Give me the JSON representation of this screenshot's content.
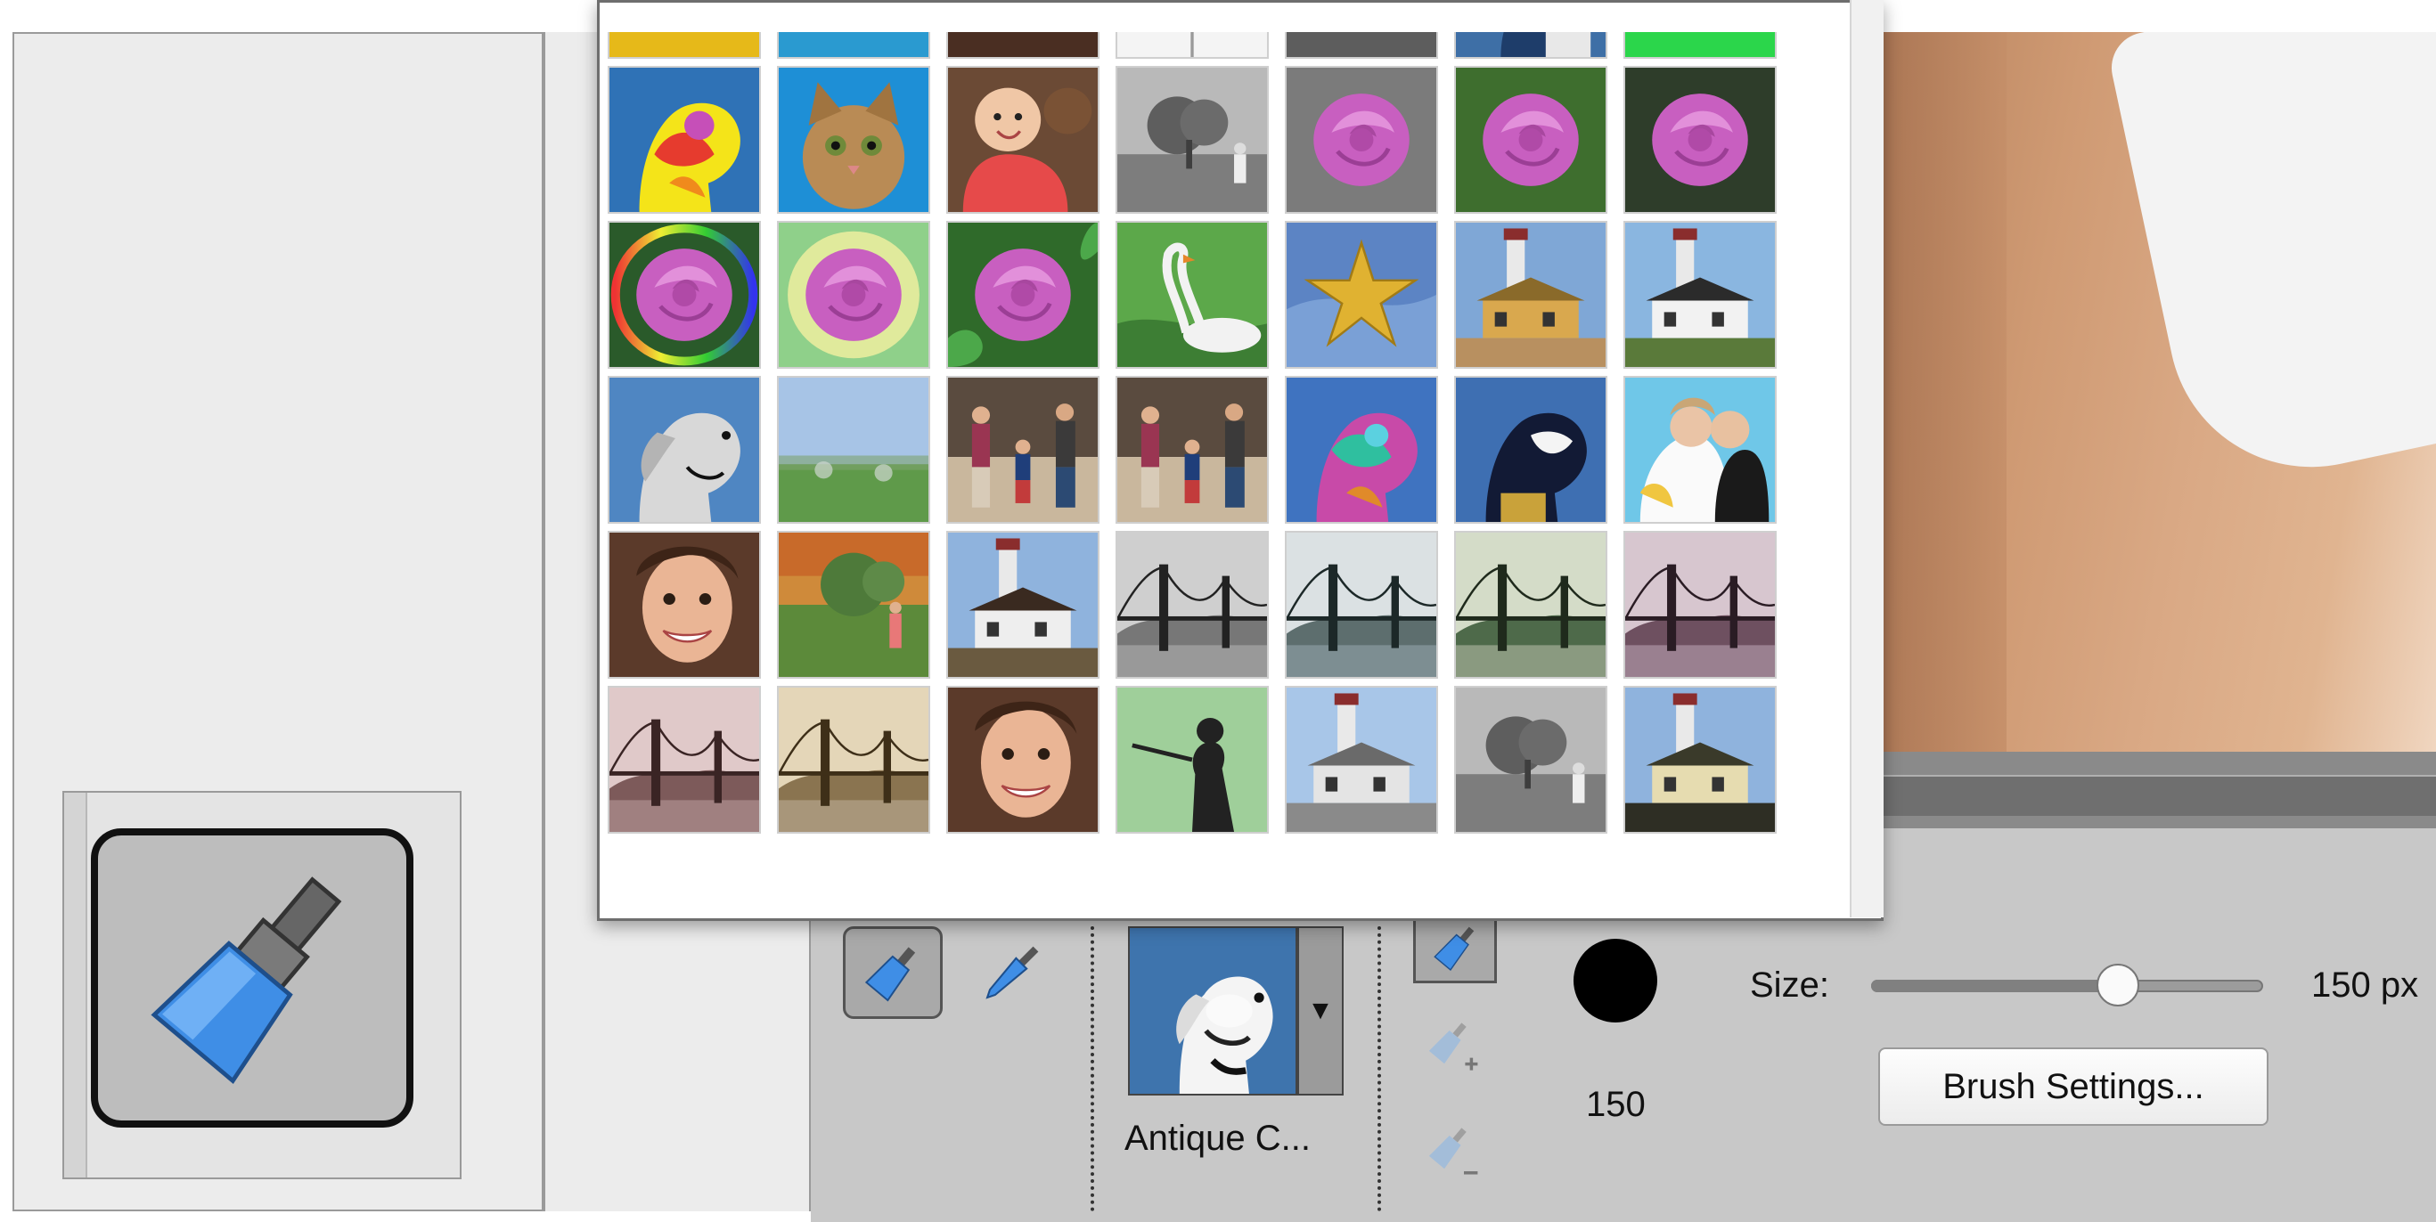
{
  "options": {
    "preset_name": "Antique C...",
    "brush_size_number": "150",
    "size_label": "Size:",
    "size_value": "150 px",
    "size_fraction": 0.63,
    "brush_settings_label": "Brush Settings...",
    "dropdown_arrow": "▼"
  },
  "gallery": {
    "thumbnails": [
      {
        "name": "thumb-child-yellow-sweater",
        "kind": "yellowtop"
      },
      {
        "name": "thumb-child-blue-sweater",
        "kind": "bluetop"
      },
      {
        "name": "thumb-girl-face-top",
        "kind": "facetop"
      },
      {
        "name": "thumb-sketch-tree-top",
        "kind": "sketchtop"
      },
      {
        "name": "thumb-gray-top",
        "kind": "graytop"
      },
      {
        "name": "thumb-dog-blue-top",
        "kind": "dogbluetop"
      },
      {
        "name": "thumb-green-top",
        "kind": "greentop"
      },
      {
        "name": "thumb-psychedelic-dog",
        "kind": "psydog"
      },
      {
        "name": "thumb-cat",
        "kind": "cat"
      },
      {
        "name": "thumb-baby-red-sweater",
        "kind": "baby"
      },
      {
        "name": "thumb-bw-tree",
        "kind": "bwtree"
      },
      {
        "name": "thumb-rose-gray-bg",
        "kind": "rosegray"
      },
      {
        "name": "thumb-rose-green-bg",
        "kind": "rosegreen"
      },
      {
        "name": "thumb-rose-dark-bg",
        "kind": "rosedark"
      },
      {
        "name": "thumb-rose-rainbow-ring",
        "kind": "rosering"
      },
      {
        "name": "thumb-rose-soft-glow",
        "kind": "roseglow"
      },
      {
        "name": "thumb-rose-leaves",
        "kind": "roseleaf"
      },
      {
        "name": "thumb-swan",
        "kind": "swan"
      },
      {
        "name": "thumb-starfish",
        "kind": "star"
      },
      {
        "name": "thumb-lighthouse-gold",
        "kind": "lhgold"
      },
      {
        "name": "thumb-lighthouse-color",
        "kind": "lhcolor"
      },
      {
        "name": "thumb-dog-sketch",
        "kind": "dogsketch"
      },
      {
        "name": "thumb-field-blur",
        "kind": "field"
      },
      {
        "name": "thumb-family-1",
        "kind": "family"
      },
      {
        "name": "thumb-family-2",
        "kind": "family"
      },
      {
        "name": "thumb-dog-pop-art",
        "kind": "dogpop"
      },
      {
        "name": "thumb-dog-dark",
        "kind": "dogdark"
      },
      {
        "name": "thumb-wedding-couple",
        "kind": "wedding"
      },
      {
        "name": "thumb-girl-face",
        "kind": "face"
      },
      {
        "name": "thumb-girl-field",
        "kind": "girlfield"
      },
      {
        "name": "thumb-lighthouse-house",
        "kind": "lhhouse"
      },
      {
        "name": "thumb-bridge-gray",
        "kind": "bridgegray"
      },
      {
        "name": "thumb-bridge-cool",
        "kind": "bridgecool"
      },
      {
        "name": "thumb-bridge-green",
        "kind": "bridgegreen"
      },
      {
        "name": "thumb-bridge-mauve",
        "kind": "bridgemauve"
      },
      {
        "name": "thumb-bridge-rose",
        "kind": "bridgerose"
      },
      {
        "name": "thumb-bridge-sepia",
        "kind": "bridgesepia"
      },
      {
        "name": "thumb-girl-face-2",
        "kind": "face"
      },
      {
        "name": "thumb-silhouette-green",
        "kind": "silhouette"
      },
      {
        "name": "thumb-lighthouse-faded",
        "kind": "lhfaded"
      },
      {
        "name": "thumb-bw-tree-2",
        "kind": "bwtree"
      },
      {
        "name": "thumb-lighthouse-antique",
        "kind": "lhantique"
      }
    ]
  }
}
